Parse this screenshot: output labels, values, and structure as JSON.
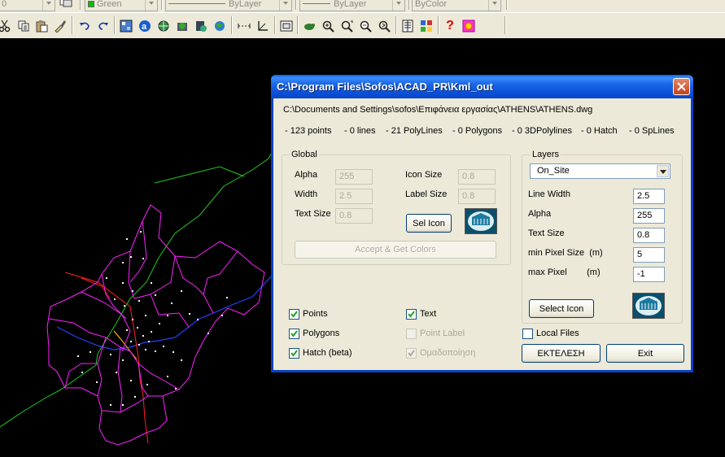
{
  "toolbar_top": {
    "layer_combo": "0",
    "color_combo": "Green",
    "linetype_combo": "ByLayer",
    "lineweight_combo": "ByLayer",
    "plotstyle_combo": "ByColor"
  },
  "toolbar_icons": [
    "cut-icon",
    "copy-icon",
    "paste-icon",
    "match-properties-icon",
    "undo-icon",
    "redo-icon",
    "design-center-icon",
    "web-icon",
    "publish-icon",
    "etransmit-icon",
    "database-icon",
    "globe-icon",
    "distance-icon",
    "ucs-icon",
    "tiled-viewport-icon",
    "pan-icon",
    "zoom-realtime-icon",
    "zoom-window-icon",
    "zoom-previous-icon",
    "zoom-extents-icon",
    "properties-icon",
    "design-center-2-icon",
    "help-icon",
    "sofos-icon"
  ],
  "dialog": {
    "title": "C:\\Program Files\\Sofos\\ACAD_PR\\Kml_out",
    "path": "C:\\Documents and Settings\\sofos\\Επιφάνεια εργασίας\\ATHENS\\ATHENS.dwg",
    "stats": [
      "- 123 points",
      "- 0 lines",
      "- 21 PolyLines",
      "- 0 Polygons",
      "- 0 3DPolylines",
      "- 0 Hatch",
      "- 0 SpLines"
    ],
    "global": {
      "legend": "Global",
      "alpha_label": "Alpha",
      "alpha_value": "255",
      "width_label": "Width",
      "width_value": "2.5",
      "textsize_label": "Text Size",
      "textsize_value": "0.8",
      "iconsize_label": "Icon Size",
      "iconsize_value": "0.8",
      "labelsize_label": "Label Size",
      "labelsize_value": "0.8",
      "sel_icon_button": "Sel Icon",
      "accept_button": "Accept & Get Colors"
    },
    "layers": {
      "legend": "Layers",
      "selected_layer": "On_Site",
      "linewidth_label": "Line Width",
      "linewidth_value": "2.5",
      "alpha_label": "Alpha",
      "alpha_value": "255",
      "textsize_label": "Text Size",
      "textsize_value": "0.8",
      "minpixel_label": "min Pixel Size  (m)",
      "minpixel_value": "5",
      "maxpixel_label": "max Pixel        (m)",
      "maxpixel_value": "-1",
      "select_icon_button": "Select Icon"
    },
    "checks": {
      "points": {
        "label": "Points",
        "checked": true
      },
      "polygons": {
        "label": "Polygons",
        "checked": true
      },
      "hatch": {
        "label": "Hatch (beta)",
        "checked": true
      },
      "text": {
        "label": "Text",
        "checked": true
      },
      "point_label": {
        "label": "Point Label",
        "checked": false
      },
      "grouping": {
        "label": "Ομαδοποίηση",
        "checked": true
      },
      "local_files": {
        "label": "Local Files",
        "checked": false
      }
    },
    "execute_button": "ΕΚΤΕΛΕΣΗ",
    "exit_button": "Exit"
  },
  "colors": {
    "titlebar": "#0a4fd6",
    "dialog_bg": "#ece9d8",
    "canvas_bg": "#000000",
    "boundary": "#ff22ff",
    "road_green": "#22cc22",
    "road_blue": "#2244ff",
    "road_red": "#ff2222",
    "road_yellow": "#ffcc00"
  }
}
